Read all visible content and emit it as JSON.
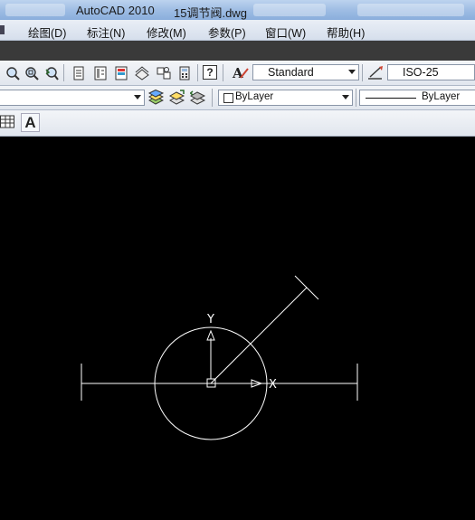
{
  "window": {
    "app_name": "AutoCAD 2010",
    "file_name": "15调节阀.dwg"
  },
  "menu": [
    {
      "label": "绘图(D)"
    },
    {
      "label": "标注(N)"
    },
    {
      "label": "修改(M)"
    },
    {
      "label": "参数(P)"
    },
    {
      "label": "窗口(W)"
    },
    {
      "label": "帮助(H)"
    }
  ],
  "toolbar": {
    "text_style": "Standard",
    "dim_style": "ISO-25",
    "color": "ByLayer",
    "linetype": "ByLayer",
    "help_glyph": "?",
    "text_glyph": "A"
  },
  "ucs": {
    "y_label": "Y",
    "x_label": "X"
  },
  "colors": {
    "canvas": "#000000",
    "geometry": "#ffffff"
  }
}
